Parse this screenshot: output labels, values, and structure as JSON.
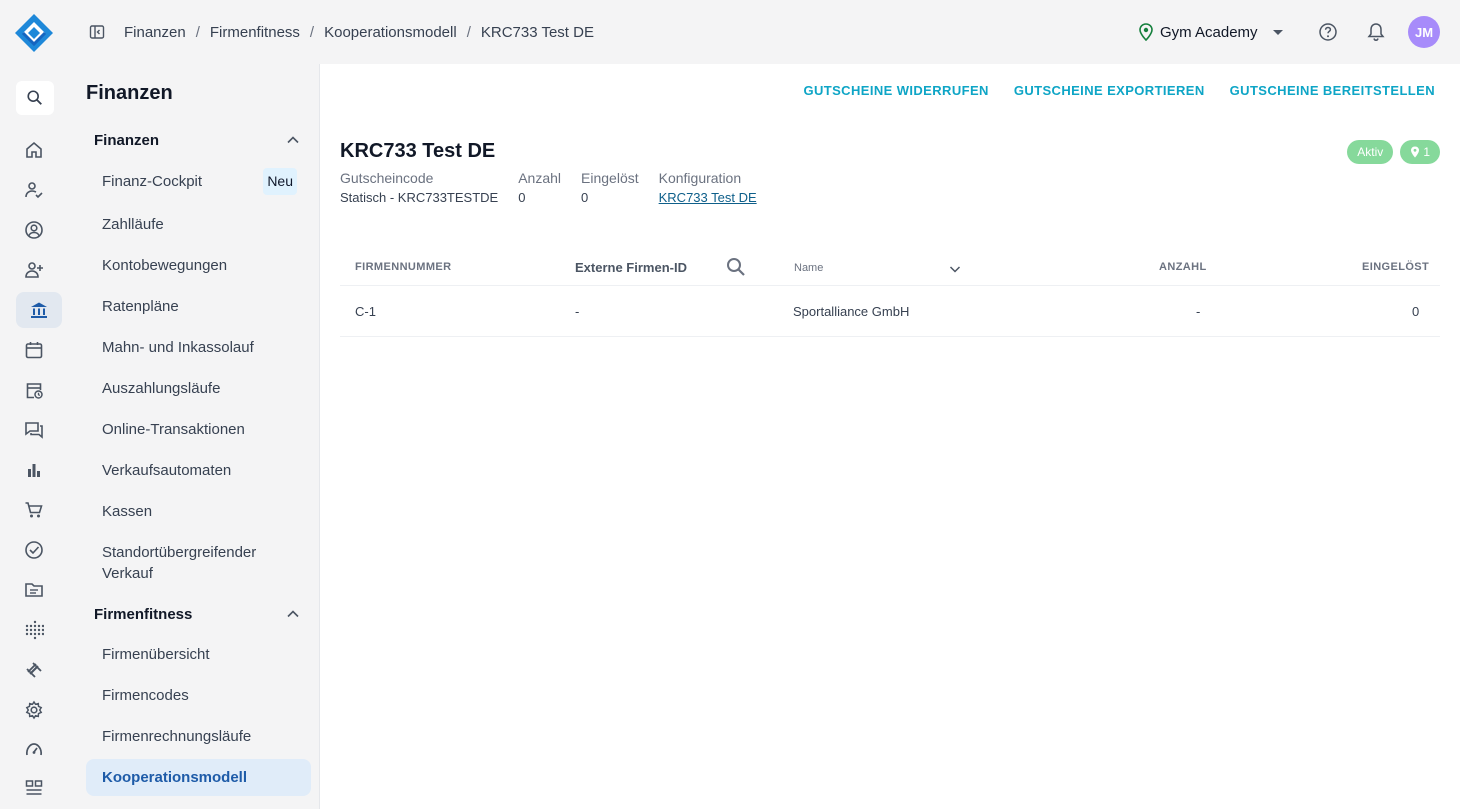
{
  "breadcrumb": [
    "Finanzen",
    "Firmenfitness",
    "Kooperationsmodell",
    "KRC733 Test DE"
  ],
  "header": {
    "studio": "Gym Academy",
    "avatar_initials": "JM"
  },
  "icons": {
    "logo": "logo-diamond-icon",
    "rail": [
      "search-icon",
      "home-icon",
      "checkin-icon",
      "member-icon",
      "add-member-icon",
      "bank-icon",
      "calendar-icon",
      "calendar-history-icon",
      "chat-icon",
      "bar-chart-icon",
      "cart-icon",
      "check-circle-icon",
      "folder-icon",
      "dots-grid-icon",
      "dumbbell-icon",
      "gear-icon",
      "dashboard-gauge-icon",
      "widgets-icon"
    ]
  },
  "colors": {
    "accent": "#0ea5c6",
    "brand": "#1e5ba8",
    "status_green": "#86d99b",
    "avatar": "#a78bfa"
  },
  "subnav": {
    "title": "Finanzen",
    "groups": [
      {
        "label": "Finanzen",
        "items": [
          "Finanz-Cockpit",
          "Zahlläufe",
          "Kontobewegungen",
          "Ratenpläne",
          "Mahn- und Inkassolauf",
          "Auszahlungsläufe",
          "Online-Transaktionen",
          "Verkaufsautomaten",
          "Kassen",
          "Standortübergreifender Verkauf"
        ]
      },
      {
        "label": "Firmenfitness",
        "items": [
          "Firmenübersicht",
          "Firmencodes",
          "Firmenrechnungsläufe",
          "Kooperationsmodell"
        ]
      }
    ],
    "new_badge": "Neu"
  },
  "actions": [
    "GUTSCHEINE WIDERRUFEN",
    "GUTSCHEINE EXPORTIEREN",
    "GUTSCHEINE BEREITSTELLEN"
  ],
  "detail": {
    "title": "KRC733 Test DE",
    "status": "Aktiv",
    "location_count": "1",
    "meta": [
      {
        "label": "Gutscheincode",
        "value": "Statisch - KRC733TESTDE"
      },
      {
        "label": "Anzahl",
        "value": "0"
      },
      {
        "label": "Eingelöst",
        "value": "0"
      },
      {
        "label": "Konfiguration",
        "value": "KRC733 Test DE"
      }
    ]
  },
  "table": {
    "headers": [
      "FIRMENNUMMER",
      "Externe Firmen-ID",
      "Name",
      "ANZAHL",
      "EINGELÖST"
    ],
    "rows": [
      [
        "C-1",
        "-",
        "Sportalliance GmbH",
        "-",
        "0"
      ]
    ]
  }
}
